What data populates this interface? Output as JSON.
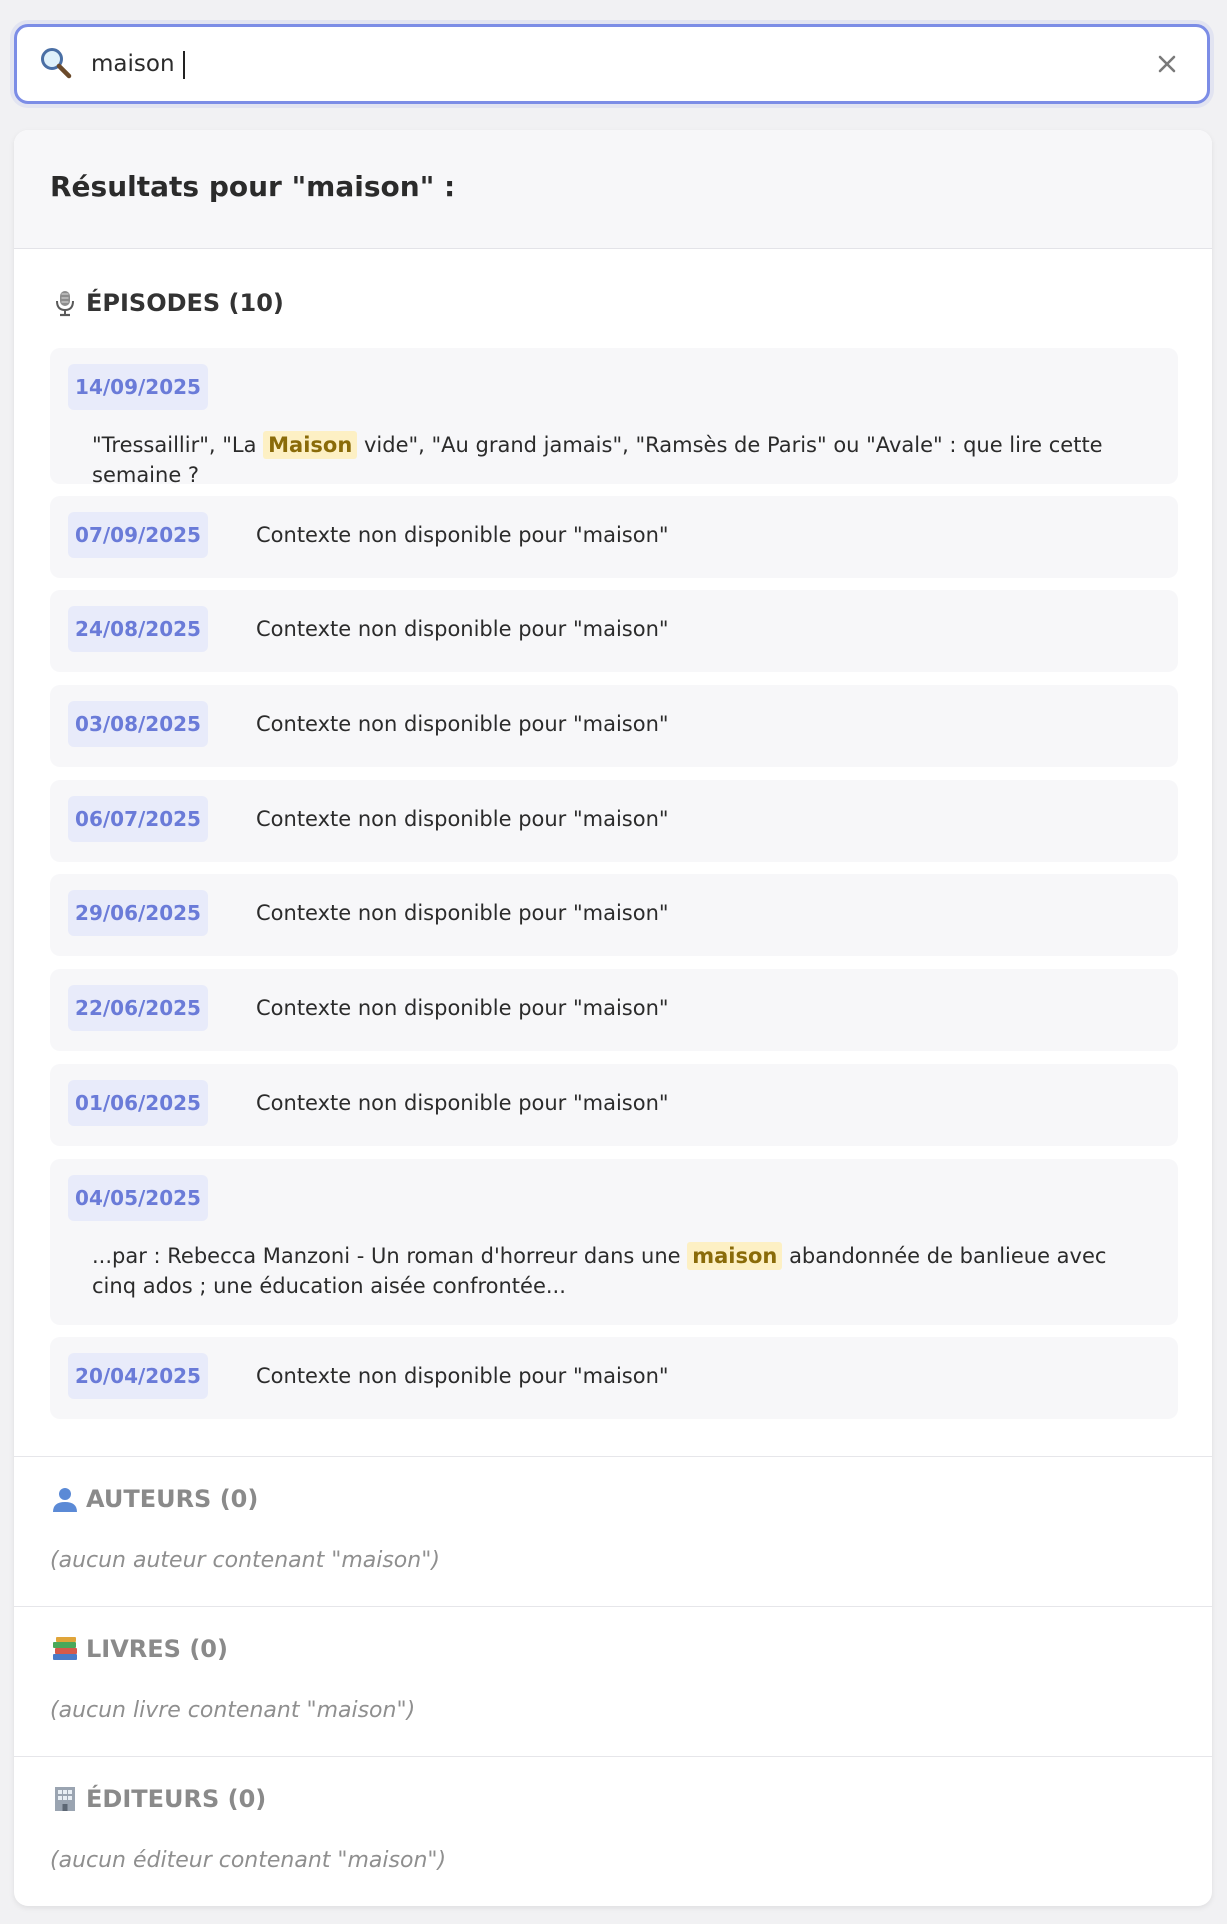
{
  "search": {
    "value": "maison",
    "clear_icon": "close-icon",
    "search_icon": "search-icon"
  },
  "results": {
    "title": "Résultats pour \"maison\" :"
  },
  "episodes": {
    "heading": "ÉPISODES (10)",
    "icon": "microphone-icon",
    "items": [
      {
        "date": "14/09/2025",
        "context_before": "\"Tressaillir\", \"La ",
        "highlight": "Maison",
        "context_after": " vide\", \"Au grand jamais\", \"Ramsès de Paris\" ou \"Avale\" : que lire cette semaine ?"
      },
      {
        "date": "07/09/2025",
        "context": "Contexte non disponible pour \"maison\""
      },
      {
        "date": "24/08/2025",
        "context": "Contexte non disponible pour \"maison\""
      },
      {
        "date": "03/08/2025",
        "context": "Contexte non disponible pour \"maison\""
      },
      {
        "date": "06/07/2025",
        "context": "Contexte non disponible pour \"maison\""
      },
      {
        "date": "29/06/2025",
        "context": "Contexte non disponible pour \"maison\""
      },
      {
        "date": "22/06/2025",
        "context": "Contexte non disponible pour \"maison\""
      },
      {
        "date": "01/06/2025",
        "context": "Contexte non disponible pour \"maison\""
      },
      {
        "date": "04/05/2025",
        "context_before": "...par : Rebecca Manzoni - Un roman d'horreur dans une ",
        "highlight": "maison",
        "context_after": " abandonnée de banlieue avec cinq ados ; une éducation aisée confrontée..."
      },
      {
        "date": "20/04/2025",
        "context": "Contexte non disponible pour \"maison\""
      }
    ]
  },
  "authors": {
    "heading": "AUTEURS (0)",
    "icon": "person-icon",
    "empty": "(aucun auteur contenant \"maison\")"
  },
  "books": {
    "heading": "LIVRES (0)",
    "icon": "books-icon",
    "empty": "(aucun livre contenant \"maison\")"
  },
  "publishers": {
    "heading": "ÉDITEURS (0)",
    "icon": "building-icon",
    "empty": "(aucun éditeur contenant \"maison\")"
  },
  "colors": {
    "accent": "#7c8de6",
    "date_badge_bg": "#e8ebfa",
    "date_badge_text": "#6a7bd8",
    "highlight_bg": "#fdf0c4",
    "highlight_text": "#8a6b09"
  }
}
